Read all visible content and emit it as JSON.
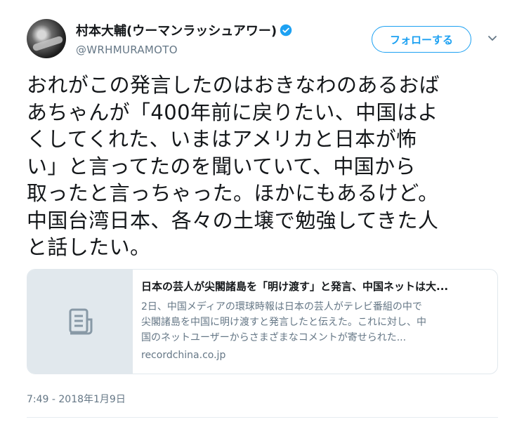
{
  "author": {
    "display_name": "村本大輔(ウーマンラッシュアワー)",
    "handle": "@WRHMURAMOTO"
  },
  "follow_button": "フォローする",
  "tweet": {
    "lines": [
      "おれがこの発言したのはおきなわのあるおば",
      "あちゃんが「400年前に戻りたい、中国はよ",
      "くしてくれた、いまはアメリカと日本が怖",
      "い」と言ってたのを聞いていて、中国から",
      "取ったと言っちゃった。ほかにもあるけど。",
      "中国台湾日本、各々の土壌で勉強してきた人",
      "と話したい。"
    ]
  },
  "card": {
    "title": "日本の芸人が尖閣諸島を「明け渡す」と発言、中国ネットは大...",
    "description_lines": [
      "2日、中国メディアの環球時報は日本の芸人がテレビ番組の中で",
      "尖閣諸島を中国に明け渡すと発言したと伝えた。これに対し、中",
      "国のネットユーザーからさまざまなコメントが寄せられた..."
    ],
    "domain": "recordchina.co.jp"
  },
  "timestamp": "7:49 - 2018年1月9日",
  "icons": {
    "verified": "verified-badge-icon",
    "caret": "chevron-down-icon",
    "card_thumb": "document-icon"
  },
  "colors": {
    "accent": "#1da1f2",
    "secondary_text": "#657786",
    "card_thumb_bg": "#e1e8ed"
  }
}
